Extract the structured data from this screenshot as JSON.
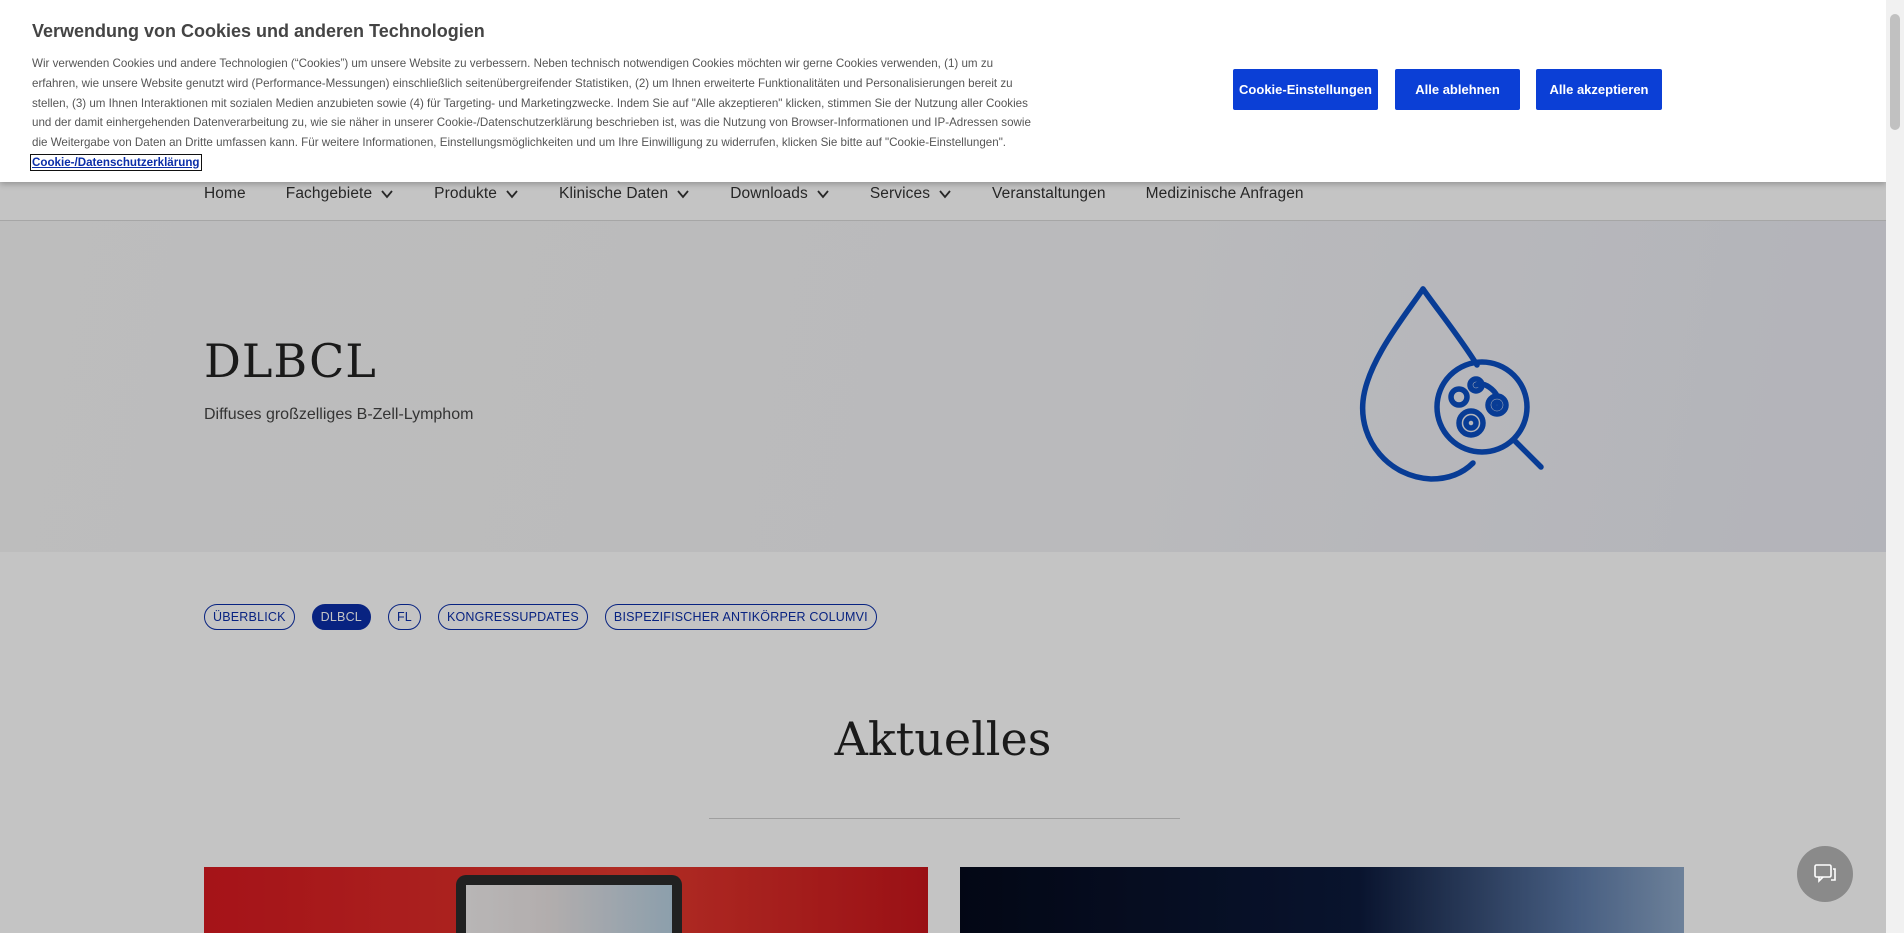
{
  "cookie_banner": {
    "title": "Verwendung von Cookies und anderen Technologien",
    "text": "Wir verwenden Cookies und andere Technologien (“Cookies”) um unsere Website zu verbessern. Neben technisch notwendigen Cookies möchten wir gerne Cookies verwenden, (1) um zu erfahren, wie unsere Website genutzt wird (Performance-Messungen) einschließlich seitenübergreifender Statistiken, (2) um Ihnen erweiterte Funktionalitäten und Personalisierungen bereit zu stellen, (3) um Ihnen Interaktionen mit sozialen Medien anzubieten sowie (4) für Targeting- und Marketingzwecke. Indem Sie auf \"Alle akzeptieren\" klicken, stimmen Sie der Nutzung aller Cookies und der damit einhergehenden Datenverarbeitung zu, wie sie näher in unserer Cookie-/Datenschutzerklärung beschrieben ist, was die Nutzung von Browser-Informationen und IP-Adressen sowie die Weitergabe von Daten an Dritte umfassen kann. Für weitere Informationen, Einstellungsmöglichkeiten und um Ihre Einwilligung zu widerrufen, klicken Sie bitte auf \"Cookie-Einstellungen\".",
    "link_label": "Cookie-/Datenschutzerklärung",
    "buttons": {
      "settings": "Cookie-Einstellungen",
      "reject_all": "Alle ablehnen",
      "accept_all": "Alle akzeptieren"
    }
  },
  "nav": {
    "items": [
      {
        "label": "Home",
        "dropdown": false
      },
      {
        "label": "Fachgebiete",
        "dropdown": true
      },
      {
        "label": "Produkte",
        "dropdown": true
      },
      {
        "label": "Klinische Daten",
        "dropdown": true
      },
      {
        "label": "Downloads",
        "dropdown": true
      },
      {
        "label": "Services",
        "dropdown": true
      },
      {
        "label": "Veranstaltungen",
        "dropdown": false
      },
      {
        "label": "Medizinische Anfragen",
        "dropdown": false
      }
    ]
  },
  "hero": {
    "title": "DLBCL",
    "subtitle": "Diffuses großzelliges B-Zell-Lymphom",
    "icon": "blood-drop-magnifier-icon"
  },
  "pills": [
    {
      "label": "ÜBERBLICK",
      "active": false
    },
    {
      "label": "DLBCL",
      "active": true
    },
    {
      "label": "FL",
      "active": false
    },
    {
      "label": "KONGRESSUPDATES",
      "active": false
    },
    {
      "label": "BISPEZIFISCHER ANTIKÖRPER COLUMVI",
      "active": false
    }
  ],
  "section": {
    "title": "Aktuelles"
  },
  "colors": {
    "primary": "#0b2ea8",
    "button": "#0b3fd6",
    "card_left": "#d71920",
    "card_right": "#0c1a3c"
  },
  "chat_icon": "chat-icon"
}
